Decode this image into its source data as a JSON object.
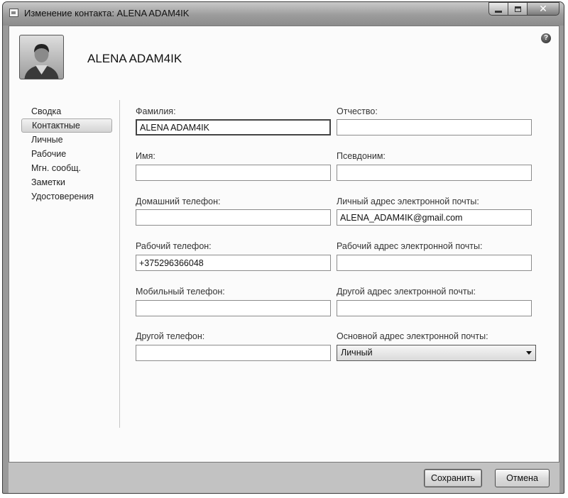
{
  "window": {
    "title": "Изменение контакта: ALENA ADAM4IK"
  },
  "header": {
    "contact_name": "ALENA ADAM4IK",
    "help": "?"
  },
  "nav": {
    "items": [
      {
        "label": "Сводка"
      },
      {
        "label": "Контактные"
      },
      {
        "label": "Личные"
      },
      {
        "label": "Рабочие"
      },
      {
        "label": "Мгн. сообщ."
      },
      {
        "label": "Заметки"
      },
      {
        "label": "Удостоверения"
      }
    ],
    "selected": "Контактные"
  },
  "form": {
    "surname": {
      "label": "Фамилия:",
      "value": "ALENA ADAM4IK"
    },
    "patronymic": {
      "label": "Отчество:",
      "value": ""
    },
    "first_name": {
      "label": "Имя:",
      "value": ""
    },
    "nickname": {
      "label": "Псевдоним:",
      "value": ""
    },
    "home_phone": {
      "label": "Домашний телефон:",
      "value": ""
    },
    "personal_email": {
      "label": "Личный адрес электронной почты:",
      "value": "ALENA_ADAM4IK@gmail.com"
    },
    "work_phone": {
      "label": "Рабочий телефон:",
      "value": "+375296366048"
    },
    "work_email": {
      "label": "Рабочий адрес электронной почты:",
      "value": ""
    },
    "mobile_phone": {
      "label": "Мобильный телефон:",
      "value": ""
    },
    "other_email": {
      "label": "Другой адрес электронной почты:",
      "value": ""
    },
    "other_phone": {
      "label": "Другой телефон:",
      "value": ""
    },
    "primary_email": {
      "label": "Основной адрес электронной почты:",
      "value": "Личный"
    }
  },
  "buttons": {
    "save": "Сохранить",
    "cancel": "Отмена"
  }
}
